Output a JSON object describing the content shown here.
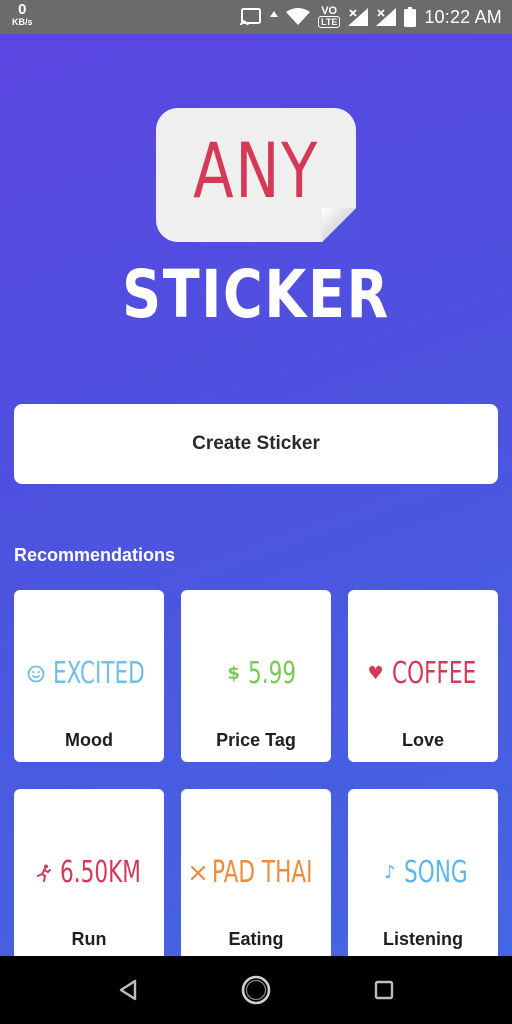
{
  "status_bar": {
    "net_speed_value": "0",
    "net_speed_unit": "KB/s",
    "volte_label": "VO",
    "lte_label": "LTE",
    "time": "10:22 AM"
  },
  "logo": {
    "word_top": "ANY",
    "word_bottom": "STICKER"
  },
  "create_button": {
    "label": "Create Sticker"
  },
  "recommendations": {
    "title": "Recommendations",
    "items": [
      {
        "label": "Mood",
        "sticker_text": "EXCITED",
        "icon": "smiley-icon",
        "icon_glyph": "☺",
        "color": "#6fc0e8"
      },
      {
        "label": "Price Tag",
        "sticker_text": "5.99",
        "icon": "dollar-icon",
        "icon_glyph": "$",
        "color": "#7cc95a"
      },
      {
        "label": "Love",
        "sticker_text": "COFFEE",
        "icon": "heart-icon",
        "icon_glyph": "♥",
        "color": "#d43a58"
      },
      {
        "label": "Run",
        "sticker_text": "6.50KM",
        "icon": "runner-icon",
        "icon_glyph": "🏃",
        "color": "#d43a58"
      },
      {
        "label": "Eating",
        "sticker_text": "PAD THAI",
        "icon": "utensils-icon",
        "icon_glyph": "✕",
        "color": "#f08a3c"
      },
      {
        "label": "Listening",
        "sticker_text": "SONG",
        "icon": "music-note-icon",
        "icon_glyph": "♪",
        "color": "#5cb8e8"
      }
    ]
  },
  "colors": {
    "background_top": "#5a46e0",
    "background_bottom": "#4566e4",
    "accent_red": "#d43a58"
  }
}
